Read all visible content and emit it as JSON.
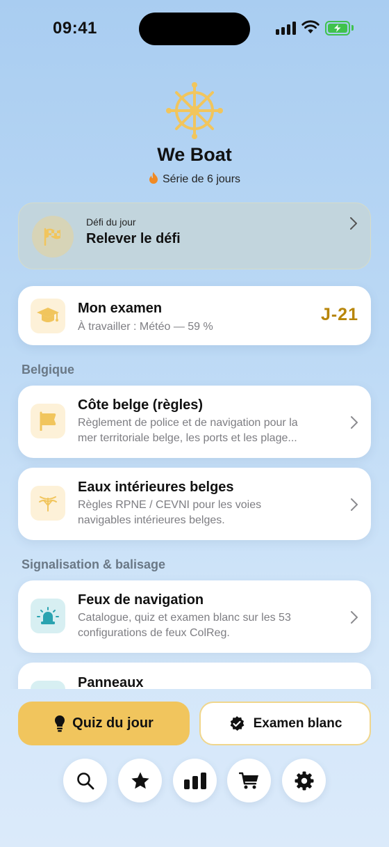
{
  "status_bar": {
    "time": "09:41"
  },
  "header": {
    "app_name": "We Boat",
    "streak_label": "Série de 6 jours",
    "logo_icon": "ship-wheel-icon",
    "accent_color": "#f1c55d"
  },
  "daily_challenge": {
    "kicker": "Défi du jour",
    "title": "Relever le défi",
    "icon": "checkered-flag-icon"
  },
  "exam": {
    "title": "Mon examen",
    "subtitle": "À travailler : Météo — 59 %",
    "countdown": "J-21",
    "icon": "graduation-cap-icon"
  },
  "sections": [
    {
      "label": "Belgique",
      "items": [
        {
          "title": "Côte belge (règles)",
          "desc_line1": "Règlement de police et de navigation pour la",
          "desc_line2": "mer territoriale belge, les ports et les plage...",
          "icon": "flag-icon"
        },
        {
          "title": "Eaux intérieures belges",
          "desc_line1": "Règles RPNE / CEVNI pour les voies",
          "desc_line2": "navigables intérieures belges.",
          "icon": "buoy-icon"
        }
      ]
    },
    {
      "label": "Signalisation & balisage",
      "items": [
        {
          "title": "Feux de navigation",
          "desc_line1": "Catalogue, quiz et examen blanc sur les 53",
          "desc_line2": "configurations de feux ColReg.",
          "icon": "beacon-light-icon"
        },
        {
          "title": "Panneaux",
          "icon": "sign-icon"
        }
      ]
    }
  ],
  "actions": {
    "primary_label": "Quiz du jour",
    "secondary_label": "Examen blanc"
  },
  "nav": [
    "search-icon",
    "star-icon",
    "stats-icon",
    "cart-icon",
    "settings-icon"
  ]
}
